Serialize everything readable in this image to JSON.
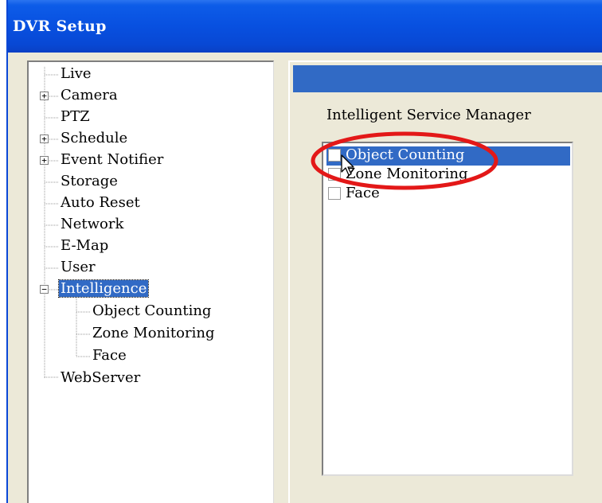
{
  "window": {
    "title": "DVR Setup"
  },
  "tree": {
    "items": [
      {
        "label": "Live"
      },
      {
        "label": "Camera"
      },
      {
        "label": "PTZ"
      },
      {
        "label": "Schedule"
      },
      {
        "label": "Event Notifier"
      },
      {
        "label": "Storage"
      },
      {
        "label": "Auto Reset"
      },
      {
        "label": "Network"
      },
      {
        "label": "E-Map"
      },
      {
        "label": "User"
      },
      {
        "label": "Intelligence"
      },
      {
        "label": "Object Counting"
      },
      {
        "label": "Zone Monitoring"
      },
      {
        "label": "Face"
      },
      {
        "label": "WebServer"
      }
    ],
    "selected": "Intelligence"
  },
  "right": {
    "section_label": "Intelligent Service Manager",
    "services": [
      {
        "label": "Object Counting",
        "checked": false
      },
      {
        "label": "Zone Monitoring",
        "checked": false
      },
      {
        "label": "Face",
        "checked": false
      }
    ],
    "selected": "Object Counting"
  },
  "colors": {
    "titlebar": "#0850e0",
    "selection": "#316ac5",
    "window_bg": "#ece9d8",
    "annotation": "#e31818"
  }
}
